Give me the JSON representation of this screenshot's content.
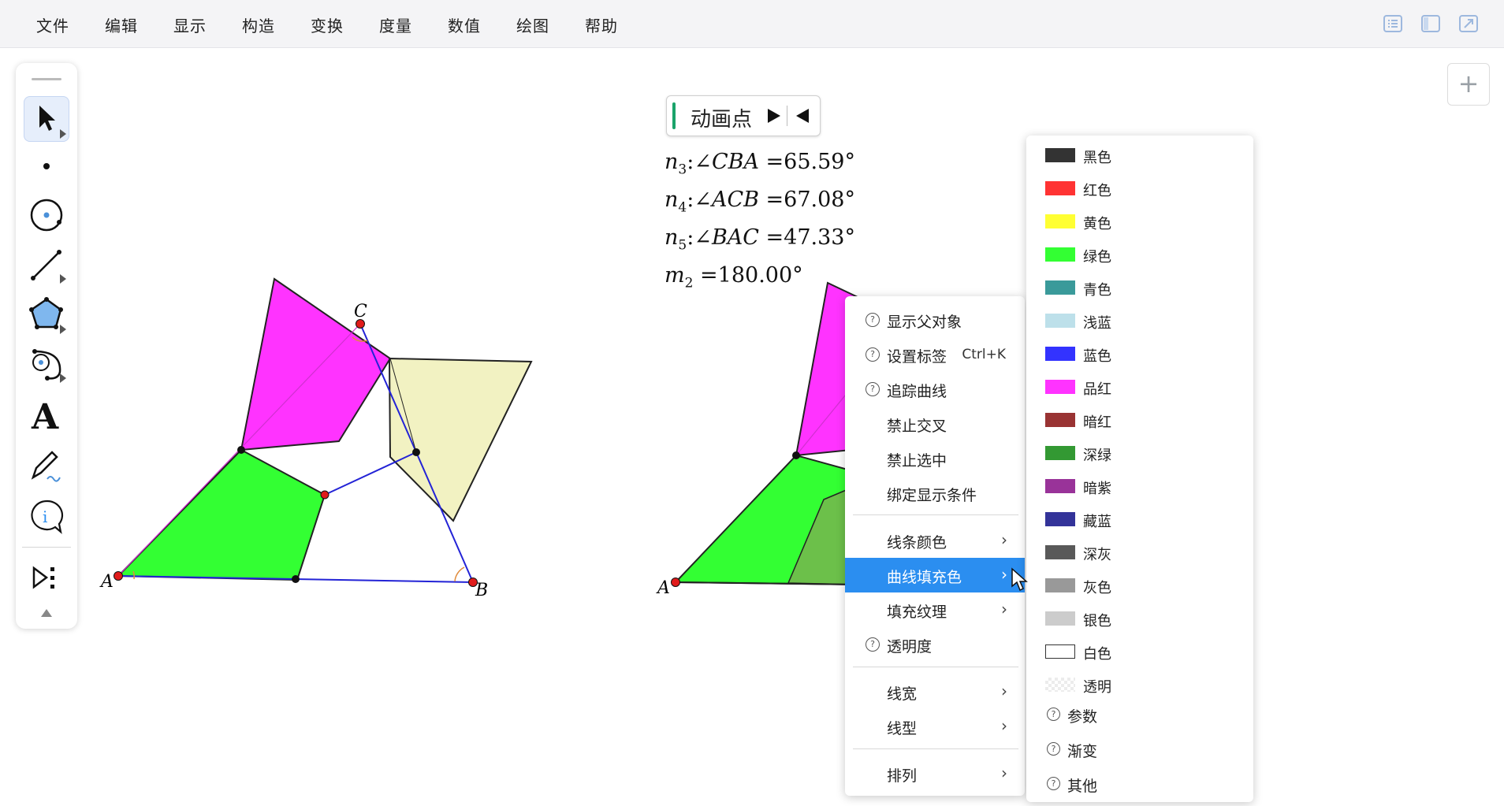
{
  "menubar": {
    "items": [
      "文件",
      "编辑",
      "显示",
      "构造",
      "变换",
      "度量",
      "数值",
      "绘图",
      "帮助"
    ]
  },
  "toolbar": {
    "tools": [
      "select-arrow-icon",
      "point-icon",
      "circle-icon",
      "segment-icon",
      "polygon-icon",
      "custom-tool-icon",
      "text-icon",
      "pen-icon",
      "info-icon",
      "more-tools-icon"
    ]
  },
  "add_button": "+",
  "animation": {
    "label": "动画点"
  },
  "measurements": [
    {
      "var": "n",
      "sub": "3",
      "expr": "∠CBA",
      "value": "65.59°"
    },
    {
      "var": "n",
      "sub": "4",
      "expr": "∠ACB",
      "value": "67.08°"
    },
    {
      "var": "n",
      "sub": "5",
      "expr": "∠BAC",
      "value": "47.33°"
    },
    {
      "var": "m",
      "sub": "2",
      "expr": "",
      "value": "180.00°"
    }
  ],
  "points": {
    "left": [
      "A",
      "B",
      "C"
    ],
    "right": [
      "A"
    ]
  },
  "context_menu": {
    "show_parents": "显示父对象",
    "set_label": "设置标签",
    "set_label_shortcut": "Ctrl+K",
    "trace_curve": "追踪曲线",
    "forbid_intersect": "禁止交叉",
    "forbid_select": "禁止选中",
    "bind_display": "绑定显示条件",
    "line_color": "线条颜色",
    "fill_color": "曲线填充色",
    "fill_texture": "填充纹理",
    "opacity": "透明度",
    "line_width": "线宽",
    "line_style": "线型",
    "arrange": "排列"
  },
  "color_menu": {
    "colors": [
      {
        "label": "黑色",
        "color": "#333333"
      },
      {
        "label": "红色",
        "color": "#ff3333"
      },
      {
        "label": "黄色",
        "color": "#ffff33"
      },
      {
        "label": "绿色",
        "color": "#33ff33"
      },
      {
        "label": "青色",
        "color": "#3a9a9a"
      },
      {
        "label": "浅蓝",
        "color": "#bde0ea"
      },
      {
        "label": "蓝色",
        "color": "#3333ff"
      },
      {
        "label": "品红",
        "color": "#ff33ff"
      },
      {
        "label": "暗红",
        "color": "#993333"
      },
      {
        "label": "深绿",
        "color": "#339933"
      },
      {
        "label": "暗紫",
        "color": "#993399"
      },
      {
        "label": "藏蓝",
        "color": "#333399"
      },
      {
        "label": "深灰",
        "color": "#595959"
      },
      {
        "label": "灰色",
        "color": "#999999"
      },
      {
        "label": "银色",
        "color": "#cccccc"
      },
      {
        "label": "白色",
        "color": "#ffffff"
      },
      {
        "label": "透明",
        "color": "transparent"
      }
    ],
    "params": "参数",
    "gradient": "渐变",
    "other": "其他"
  }
}
